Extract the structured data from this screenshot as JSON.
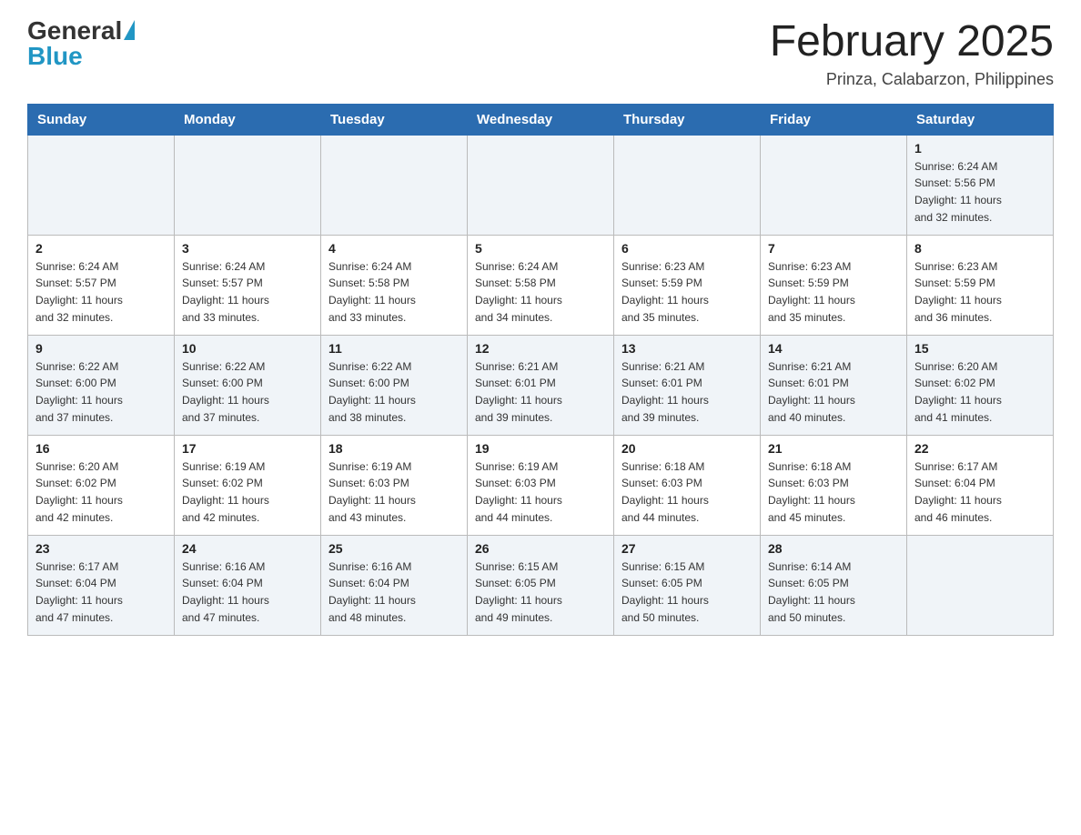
{
  "header": {
    "logo_general": "General",
    "logo_blue": "Blue",
    "month_title": "February 2025",
    "location": "Prinza, Calabarzon, Philippines"
  },
  "days_of_week": [
    "Sunday",
    "Monday",
    "Tuesday",
    "Wednesday",
    "Thursday",
    "Friday",
    "Saturday"
  ],
  "weeks": [
    {
      "days": [
        {
          "number": "",
          "info": ""
        },
        {
          "number": "",
          "info": ""
        },
        {
          "number": "",
          "info": ""
        },
        {
          "number": "",
          "info": ""
        },
        {
          "number": "",
          "info": ""
        },
        {
          "number": "",
          "info": ""
        },
        {
          "number": "1",
          "info": "Sunrise: 6:24 AM\nSunset: 5:56 PM\nDaylight: 11 hours\nand 32 minutes."
        }
      ]
    },
    {
      "days": [
        {
          "number": "2",
          "info": "Sunrise: 6:24 AM\nSunset: 5:57 PM\nDaylight: 11 hours\nand 32 minutes."
        },
        {
          "number": "3",
          "info": "Sunrise: 6:24 AM\nSunset: 5:57 PM\nDaylight: 11 hours\nand 33 minutes."
        },
        {
          "number": "4",
          "info": "Sunrise: 6:24 AM\nSunset: 5:58 PM\nDaylight: 11 hours\nand 33 minutes."
        },
        {
          "number": "5",
          "info": "Sunrise: 6:24 AM\nSunset: 5:58 PM\nDaylight: 11 hours\nand 34 minutes."
        },
        {
          "number": "6",
          "info": "Sunrise: 6:23 AM\nSunset: 5:59 PM\nDaylight: 11 hours\nand 35 minutes."
        },
        {
          "number": "7",
          "info": "Sunrise: 6:23 AM\nSunset: 5:59 PM\nDaylight: 11 hours\nand 35 minutes."
        },
        {
          "number": "8",
          "info": "Sunrise: 6:23 AM\nSunset: 5:59 PM\nDaylight: 11 hours\nand 36 minutes."
        }
      ]
    },
    {
      "days": [
        {
          "number": "9",
          "info": "Sunrise: 6:22 AM\nSunset: 6:00 PM\nDaylight: 11 hours\nand 37 minutes."
        },
        {
          "number": "10",
          "info": "Sunrise: 6:22 AM\nSunset: 6:00 PM\nDaylight: 11 hours\nand 37 minutes."
        },
        {
          "number": "11",
          "info": "Sunrise: 6:22 AM\nSunset: 6:00 PM\nDaylight: 11 hours\nand 38 minutes."
        },
        {
          "number": "12",
          "info": "Sunrise: 6:21 AM\nSunset: 6:01 PM\nDaylight: 11 hours\nand 39 minutes."
        },
        {
          "number": "13",
          "info": "Sunrise: 6:21 AM\nSunset: 6:01 PM\nDaylight: 11 hours\nand 39 minutes."
        },
        {
          "number": "14",
          "info": "Sunrise: 6:21 AM\nSunset: 6:01 PM\nDaylight: 11 hours\nand 40 minutes."
        },
        {
          "number": "15",
          "info": "Sunrise: 6:20 AM\nSunset: 6:02 PM\nDaylight: 11 hours\nand 41 minutes."
        }
      ]
    },
    {
      "days": [
        {
          "number": "16",
          "info": "Sunrise: 6:20 AM\nSunset: 6:02 PM\nDaylight: 11 hours\nand 42 minutes."
        },
        {
          "number": "17",
          "info": "Sunrise: 6:19 AM\nSunset: 6:02 PM\nDaylight: 11 hours\nand 42 minutes."
        },
        {
          "number": "18",
          "info": "Sunrise: 6:19 AM\nSunset: 6:03 PM\nDaylight: 11 hours\nand 43 minutes."
        },
        {
          "number": "19",
          "info": "Sunrise: 6:19 AM\nSunset: 6:03 PM\nDaylight: 11 hours\nand 44 minutes."
        },
        {
          "number": "20",
          "info": "Sunrise: 6:18 AM\nSunset: 6:03 PM\nDaylight: 11 hours\nand 44 minutes."
        },
        {
          "number": "21",
          "info": "Sunrise: 6:18 AM\nSunset: 6:03 PM\nDaylight: 11 hours\nand 45 minutes."
        },
        {
          "number": "22",
          "info": "Sunrise: 6:17 AM\nSunset: 6:04 PM\nDaylight: 11 hours\nand 46 minutes."
        }
      ]
    },
    {
      "days": [
        {
          "number": "23",
          "info": "Sunrise: 6:17 AM\nSunset: 6:04 PM\nDaylight: 11 hours\nand 47 minutes."
        },
        {
          "number": "24",
          "info": "Sunrise: 6:16 AM\nSunset: 6:04 PM\nDaylight: 11 hours\nand 47 minutes."
        },
        {
          "number": "25",
          "info": "Sunrise: 6:16 AM\nSunset: 6:04 PM\nDaylight: 11 hours\nand 48 minutes."
        },
        {
          "number": "26",
          "info": "Sunrise: 6:15 AM\nSunset: 6:05 PM\nDaylight: 11 hours\nand 49 minutes."
        },
        {
          "number": "27",
          "info": "Sunrise: 6:15 AM\nSunset: 6:05 PM\nDaylight: 11 hours\nand 50 minutes."
        },
        {
          "number": "28",
          "info": "Sunrise: 6:14 AM\nSunset: 6:05 PM\nDaylight: 11 hours\nand 50 minutes."
        },
        {
          "number": "",
          "info": ""
        }
      ]
    }
  ]
}
